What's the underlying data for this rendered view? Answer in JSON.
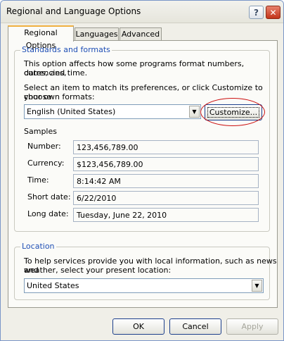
{
  "window": {
    "title": "Regional and Language Options",
    "help_button": "?",
    "close_button": "✕"
  },
  "tabs": [
    {
      "label": "Regional Options",
      "active": true
    },
    {
      "label": "Languages",
      "active": false
    },
    {
      "label": "Advanced",
      "active": false
    }
  ],
  "standards": {
    "group_title": "Standards and formats",
    "description_line1": "This option affects how some programs format numbers, currencies,",
    "description_line2": "dates, and time.",
    "select_prompt_line1": "Select an item to match its preferences, or click Customize to choose",
    "select_prompt_line2": "your own formats:",
    "selected_locale": "English (United States)",
    "customize_label": "Customize..."
  },
  "samples": {
    "heading": "Samples",
    "rows": [
      {
        "label": "Number:",
        "value": "123,456,789.00"
      },
      {
        "label": "Currency:",
        "value": "$123,456,789.00"
      },
      {
        "label": "Time:",
        "value": "8:14:42 AM"
      },
      {
        "label": "Short date:",
        "value": "6/22/2010"
      },
      {
        "label": "Long date:",
        "value": "Tuesday, June 22, 2010"
      }
    ]
  },
  "location": {
    "group_title": "Location",
    "description_line1": "To help services provide you with local information, such as news and",
    "description_line2": "weather, select your present location:",
    "selected_location": "United States"
  },
  "footer": {
    "ok_label": "OK",
    "cancel_label": "Cancel",
    "apply_label": "Apply"
  },
  "icons": {
    "dropdown_arrow": "▼"
  },
  "colors": {
    "group_title": "#1f4fb5",
    "annotation": "#cc1111",
    "active_tab_accent": "#f0b040"
  }
}
